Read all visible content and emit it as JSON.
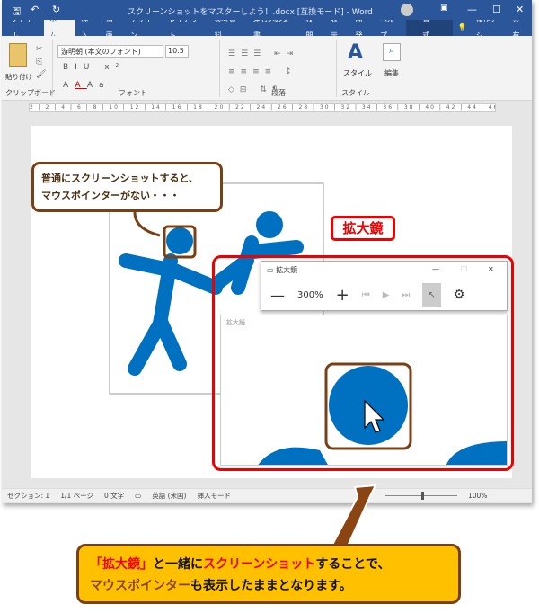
{
  "window": {
    "title": "スクリーンショットをマスターしよう！.docx [互換モード] - Word"
  },
  "tabs": [
    "ファイル",
    "ホーム",
    "挿入",
    "描画",
    "デザイン",
    "レイアウト",
    "参考資料",
    "差し込み文書",
    "校閲",
    "表示",
    "開発",
    "ヘルプ"
  ],
  "context_tab": "書式",
  "tell_me": "操作アシ",
  "share": "共有",
  "ribbon": {
    "paste": "貼り付け",
    "font_name": "游明朝 (本文のフォント)",
    "font_size": "10.5",
    "style_btn": "スタイル",
    "edit_btn": "編集",
    "groups": [
      "クリップボード",
      "フォント",
      "段落",
      "スタイル"
    ]
  },
  "ruler": "2 | 2 | 4 | 6 | 8 | 10 | 12 | 14 | 16 | 18 | 20 | 22 | 24 | 26 | 28 | 30 | 32 | 34 | 36 | 38 | 40 | 42 | 44 | 46 | 48 | 52",
  "callout_top": [
    "普通にスクリーンショットすると、",
    "マウスポインターがない・・・"
  ],
  "magnifier_label": "拡大鏡",
  "magnifier": {
    "title": "拡大鏡",
    "zoom": "300%",
    "view_title": "拡大鏡"
  },
  "status": {
    "section": "セクション: 1",
    "page": "1/1 ページ",
    "words": "0 文字",
    "lang": "英語 (米国)",
    "mode": "挿入モード",
    "zoom": "100%",
    "zoom_percent": 100
  },
  "callout_bottom": {
    "l1a": "「拡大鏡」",
    "l1b": "と一緒に",
    "l1c": "スクリーンショット",
    "l1d": "することで、",
    "l2a": "マウスポインター",
    "l2b": "も表示したままとなります。"
  },
  "colors": {
    "word_blue": "#2b579a",
    "figure_blue": "#0070c0",
    "highlight_red": "#e00000",
    "callout_yellow": "#ffc000",
    "brown": "#7b3f14"
  }
}
